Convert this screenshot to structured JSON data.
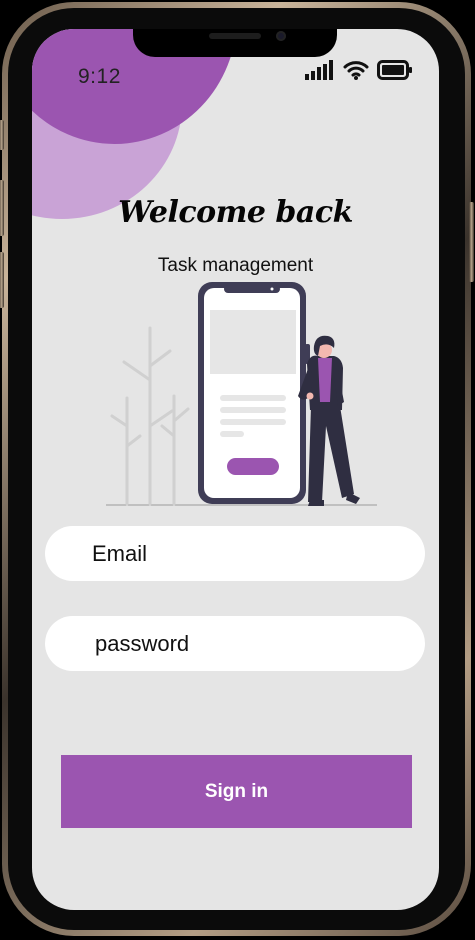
{
  "status_bar": {
    "time": "9:12",
    "signal_icon": "cellular-signal-icon",
    "wifi_icon": "wifi-icon",
    "battery_icon": "battery-icon"
  },
  "header": {
    "title": "Welcome back",
    "subtitle": "Task management"
  },
  "form": {
    "email_placeholder": "Email",
    "password_placeholder": "password",
    "signin_label": "Sign in"
  },
  "colors": {
    "accent": "#9b55b0",
    "accent_light": "#c9a3d6",
    "background": "#e5e5e5"
  }
}
